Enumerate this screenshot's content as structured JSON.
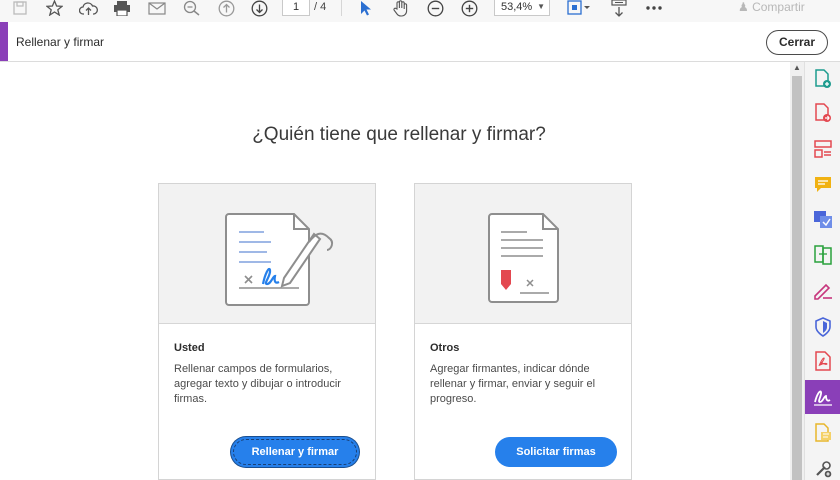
{
  "toolbar": {
    "page_current": "1",
    "page_total": "/ 4",
    "zoom": "53,4%",
    "share_label": "Compartir"
  },
  "tool": {
    "title": "Rellenar y firmar",
    "close_label": "Cerrar",
    "accent": "#8a3fb8"
  },
  "main": {
    "heading": "¿Quién tiene que rellenar y firmar?",
    "cards": [
      {
        "title": "Usted",
        "description": "Rellenar campos de formularios, agregar texto y dibujar o introducir firmas.",
        "button": "Rellenar y firmar"
      },
      {
        "title": "Otros",
        "description": "Agregar firmantes, indicar dónde rellenar y firmar, enviar y seguir el progreso.",
        "button": "Solicitar firmas"
      }
    ]
  },
  "rail": {
    "items": [
      "create-pdf-icon",
      "export-pdf-icon",
      "organize-pages-icon",
      "comment-icon",
      "send-for-review-icon",
      "compare-files-icon",
      "redact-icon",
      "protect-icon",
      "pdf-standards-icon",
      "fill-and-sign-icon",
      "scan-ocr-icon",
      "more-tools-icon"
    ]
  },
  "colors": {
    "primary_button": "#2680eb",
    "tool_accent": "#8a3fb8"
  }
}
